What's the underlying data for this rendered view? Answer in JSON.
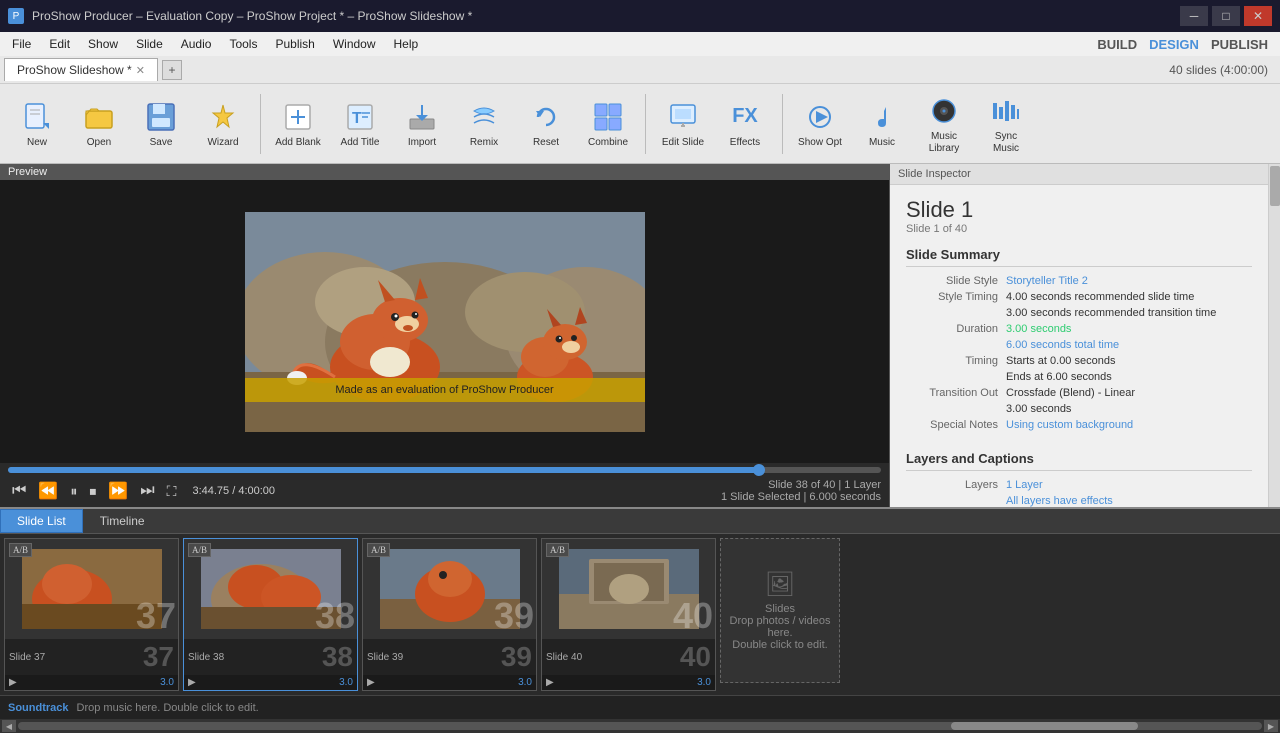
{
  "window": {
    "title": "ProShow Producer – Evaluation Copy – ProShow Project * – ProShow Slideshow *",
    "icon": "P"
  },
  "menu": {
    "items": [
      "File",
      "Edit",
      "Show",
      "Slide",
      "Audio",
      "Tools",
      "Publish",
      "Window",
      "Help"
    ],
    "build": "BUILD",
    "design": "DESIGN",
    "publish": "PUBLISH"
  },
  "tab": {
    "label": "ProShow Slideshow *",
    "slide_count": "40 slides (4:00:00)"
  },
  "toolbar": {
    "buttons": [
      {
        "id": "new",
        "label": "New",
        "icon": "📄"
      },
      {
        "id": "open",
        "label": "Open",
        "icon": "📂"
      },
      {
        "id": "save",
        "label": "Save",
        "icon": "💾"
      },
      {
        "id": "wizard",
        "label": "Wizard",
        "icon": "🪄"
      },
      {
        "id": "add-blank",
        "label": "Add Blank",
        "icon": "➕"
      },
      {
        "id": "add-title",
        "label": "Add Title",
        "icon": "T"
      },
      {
        "id": "import",
        "label": "Import",
        "icon": "⬇"
      },
      {
        "id": "remix",
        "label": "Remix",
        "icon": "🔄"
      },
      {
        "id": "reset",
        "label": "Reset",
        "icon": "↺"
      },
      {
        "id": "combine",
        "label": "Combine",
        "icon": "⊞"
      },
      {
        "id": "edit-slide",
        "label": "Edit Slide",
        "icon": "✏"
      },
      {
        "id": "fx",
        "label": "FX",
        "icon": "FX"
      },
      {
        "id": "show-opt",
        "label": "Show Opt",
        "icon": "🔊"
      },
      {
        "id": "music",
        "label": "Music",
        "icon": "🎵"
      },
      {
        "id": "music-library",
        "label": "Music Library",
        "icon": "🎶"
      },
      {
        "id": "sync-music",
        "label": "Sync Music",
        "icon": "🎼"
      }
    ]
  },
  "preview": {
    "label": "Preview",
    "watermark": "Made as an evaluation of  ProShow Producer",
    "progress": 86,
    "time_current": "3:44.75",
    "time_total": "4:00:00",
    "slide_info_line1": "Slide 38 of 40  |  1 Layer",
    "slide_info_line2": "1 Slide Selected  |  6.000 seconds"
  },
  "inspector": {
    "label": "Slide Inspector",
    "slide_title": "Slide 1",
    "slide_subtitle": "Slide 1 of 40",
    "summary_title": "Slide Summary",
    "rows": [
      {
        "label": "Slide Style",
        "value": "Storyteller Title 2",
        "link": true
      },
      {
        "label": "Style Timing",
        "value": "4.00 seconds recommended slide time",
        "link": false
      },
      {
        "label": "",
        "value": "3.00 seconds recommended transition time",
        "link": false
      },
      {
        "label": "Duration",
        "value": "3.00 seconds",
        "link": false,
        "color": "green"
      },
      {
        "label": "",
        "value": "6.00 seconds total time",
        "link": false,
        "color": "blue"
      },
      {
        "label": "Timing",
        "value": "Starts at 0.00 seconds",
        "link": false
      },
      {
        "label": "",
        "value": "Ends at 6.00 seconds",
        "link": false
      },
      {
        "label": "Transition Out",
        "value": "Crossfade (Blend) - Linear",
        "link": false
      },
      {
        "label": "",
        "value": "3.00 seconds",
        "link": false
      },
      {
        "label": "Special Notes",
        "value": "Using custom background",
        "link": true
      }
    ],
    "layers_title": "Layers and Captions",
    "layers_rows": [
      {
        "label": "Layers",
        "value": "1 Layer",
        "link": false,
        "color": "blue"
      },
      {
        "label": "",
        "value": "All layers have effects",
        "link": true
      }
    ]
  },
  "bottom": {
    "tabs": [
      "Slide List",
      "Timeline"
    ],
    "active_tab": "Slide List",
    "slides": [
      {
        "num": 37,
        "label": "Slide 37",
        "duration": "3.0",
        "big_num": "37"
      },
      {
        "num": 38,
        "label": "Slide 38",
        "duration": "3.0",
        "big_num": "38",
        "active": true
      },
      {
        "num": 39,
        "label": "Slide 39",
        "duration": "3.0",
        "big_num": "39"
      },
      {
        "num": 40,
        "label": "Slide 40",
        "duration": "3.0",
        "big_num": "40"
      }
    ],
    "empty_label_line1": "Slides",
    "empty_label_line2": "Drop photos / videos here.",
    "empty_label_line3": "Double click to edit.",
    "soundtrack_label": "Soundtrack",
    "soundtrack_hint": "Drop music here.  Double click to edit."
  }
}
